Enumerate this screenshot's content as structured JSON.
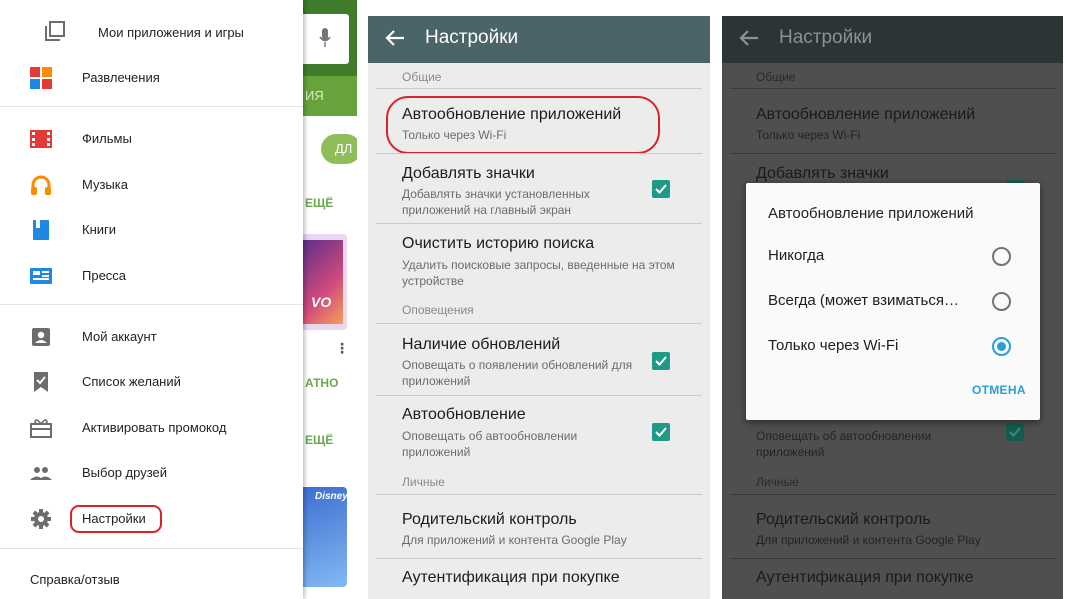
{
  "drawer": {
    "my_apps": "Мои приложения и игры",
    "items": [
      {
        "label": "Развлечения",
        "icon": "entertainment-icon"
      },
      {
        "label": "Фильмы",
        "icon": "movies-icon"
      },
      {
        "label": "Музыка",
        "icon": "headphones-icon"
      },
      {
        "label": "Книги",
        "icon": "books-icon"
      },
      {
        "label": "Пресса",
        "icon": "newsstand-icon"
      },
      {
        "label": "Мой аккаунт",
        "icon": "account-icon"
      },
      {
        "label": "Список желаний",
        "icon": "wishlist-icon"
      },
      {
        "label": "Активировать промокод",
        "icon": "redeem-icon"
      },
      {
        "label": "Выбор друзей",
        "icon": "people-icon"
      },
      {
        "label": "Настройки",
        "icon": "gear-icon"
      }
    ],
    "help": "Справка/отзыв"
  },
  "background_app": {
    "green_label": "ИЯ",
    "chip": "ДЛ",
    "more1": "ЕЩЁ",
    "free": "АТНО",
    "more2": "ЕЩЁ",
    "card_text": "VO",
    "disney": "Disney"
  },
  "settings": {
    "title": "Настройки",
    "sections": {
      "general": "Общие",
      "notifications": "Оповещения",
      "personal": "Личные"
    },
    "rows": [
      {
        "title": "Автообновление приложений",
        "subtitle": "Только через Wi-Fi"
      },
      {
        "title": "Добавлять значки",
        "subtitle": "Добавлять значки установленных приложений на главный экран",
        "checked": true
      },
      {
        "title": "Очистить историю поиска",
        "subtitle": "Удалить поисковые запросы, введенные на этом устройстве"
      },
      {
        "title": "Наличие обновлений",
        "subtitle": "Оповещать о появлении обновлений для приложений",
        "checked": true
      },
      {
        "title": "Автообновление",
        "subtitle": "Оповещать об автообновлении приложений",
        "checked": true
      },
      {
        "title": "Родительский контроль",
        "subtitle": "Для приложений и контента Google Play"
      },
      {
        "title": "Аутентификация при покупке",
        "subtitle": ""
      }
    ]
  },
  "dialog": {
    "title": "Автообновление приложений",
    "options": [
      {
        "label": "Никогда",
        "selected": false
      },
      {
        "label": "Всегда (может взиматься…",
        "selected": false
      },
      {
        "label": "Только через Wi-Fi",
        "selected": true
      }
    ],
    "cancel": "ОТМЕНА"
  },
  "colors": {
    "toolbar": "#4a6468",
    "accent": "#1f9a87",
    "highlight_oval": "#d8232a",
    "radio_on": "#2a9fd6"
  }
}
